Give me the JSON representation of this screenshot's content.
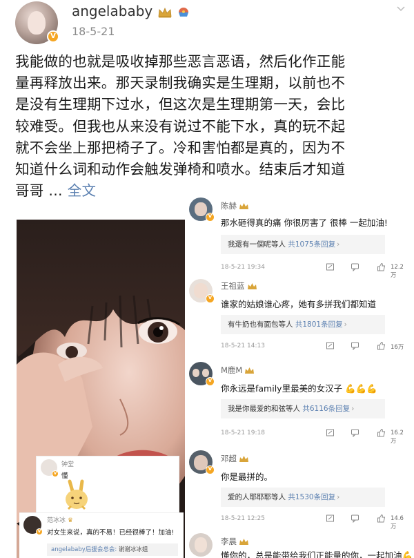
{
  "post": {
    "username": "angelababy",
    "date": "18-5-21",
    "body_lines": [
      "我能做的也就是吸收掉那些恶言恶语，然后化作正能",
      "量再释放出来。那天录制我确实是生理期，以前也不",
      "是没有生理期下过水，但这次是生理期第一天，会比",
      "较难受。但我也从来没有说过不能下水，真的玩不起",
      "就不会坐上那把椅子了。冷和害怕都是真的，因为不",
      "知道什么词和动作会触发弹椅和喷水。结束后才知道"
    ],
    "last_line": "哥哥 ...",
    "full_text_link": "全文"
  },
  "comments": [
    {
      "name": "陈赫",
      "text": "那水砸得真的痛 你很厉害了 很棒 一起加油!",
      "reply_prefix": "我還有一個呢等人",
      "reply_count": "共1075条回复",
      "time": "18-5-21 19:34",
      "likes": "12.2万"
    },
    {
      "name": "王祖蓝",
      "text": "谁家的姑娘谁心疼，她有多拼我们都知道",
      "reply_prefix": "有牛奶也有面包等人",
      "reply_count": "共1801条回复",
      "time": "18-5-21 14:13",
      "likes": "16万"
    },
    {
      "name": "M鹿M",
      "text": "你永远是family里最美的女汉子",
      "reply_prefix": "我是你最爱的和弦等人",
      "reply_count": "共6116条回复",
      "time": "18-5-21 19:18",
      "likes": "16.2万"
    },
    {
      "name": "邓超",
      "text": "你是最拼的。",
      "reply_prefix": "爱的人耶耶耶等人",
      "reply_count": "共1530条回复",
      "time": "18-5-21 12:25",
      "likes": "14.6万"
    },
    {
      "name": "李晨",
      "text": "懂你的，总是能带给我们正能量的你，一起加油"
    }
  ],
  "mini_comments": [
    {
      "name": "钟堂",
      "text": "懂"
    },
    {
      "name": "范冰冰",
      "text": "对女生来说，真的不易！已经很棒了！加油!",
      "reply_name": "angelababy后援会总会:",
      "reply_text": "谢谢冰冰姐"
    }
  ],
  "colors": {
    "link": "#5a7fb0",
    "verified_badge": "#f5a623",
    "crown": "#d9a53a"
  }
}
